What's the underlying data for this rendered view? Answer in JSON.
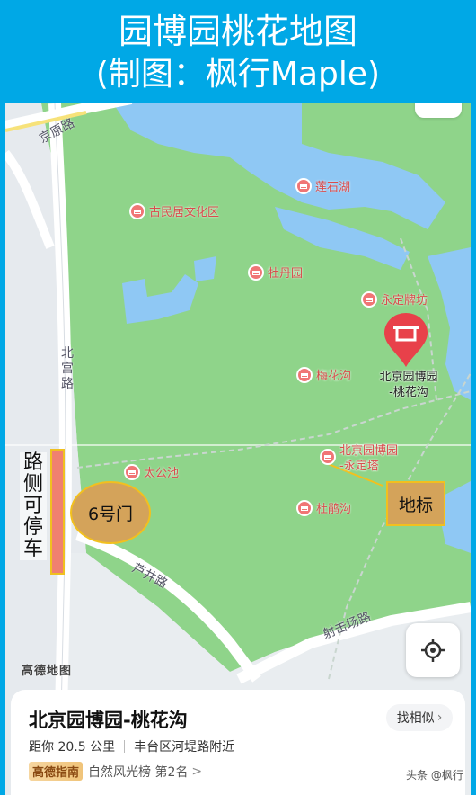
{
  "header": {
    "title_line1": "园博园桃花地图",
    "title_line2": "(制图：枫行Maple)"
  },
  "map": {
    "pois": {
      "lianshihu": "莲石湖",
      "guminju": "古民居文化区",
      "mudanyuan": "牡丹园",
      "yongding_paifang": "永定牌坊",
      "meihuagou": "梅花沟",
      "taigongchi": "太公池",
      "dupenggou": "杜鹃沟"
    },
    "pins": {
      "taohuagou": "北京园博园\n-桃花沟",
      "yongdingta": "北京园博园\n-永定塔"
    },
    "roads": {
      "jingyuan": "京原路",
      "beigong": "北宫路",
      "luyi": "芦井路",
      "sheji": "射击场路"
    },
    "annotations": {
      "parking": "路侧可停车",
      "gate": "6号门",
      "landmark": "地标"
    },
    "logo": "高德地图",
    "colors": {
      "water": "#8fc8f4",
      "park": "#8fd48a",
      "accent_red": "#e8414a",
      "annotation_fill": "#d4a35a",
      "annotation_border": "#f2c01e"
    }
  },
  "card": {
    "title": "北京园博园-桃花沟",
    "similar_button": "找相似",
    "distance": "距你 20.5 公里",
    "address": "丰台区河堤路附近",
    "rank_badge": "高德指南",
    "rank_text": "自然风光榜 第2名",
    "rank_arrow": ">"
  },
  "watermark": "头条 @枫行"
}
